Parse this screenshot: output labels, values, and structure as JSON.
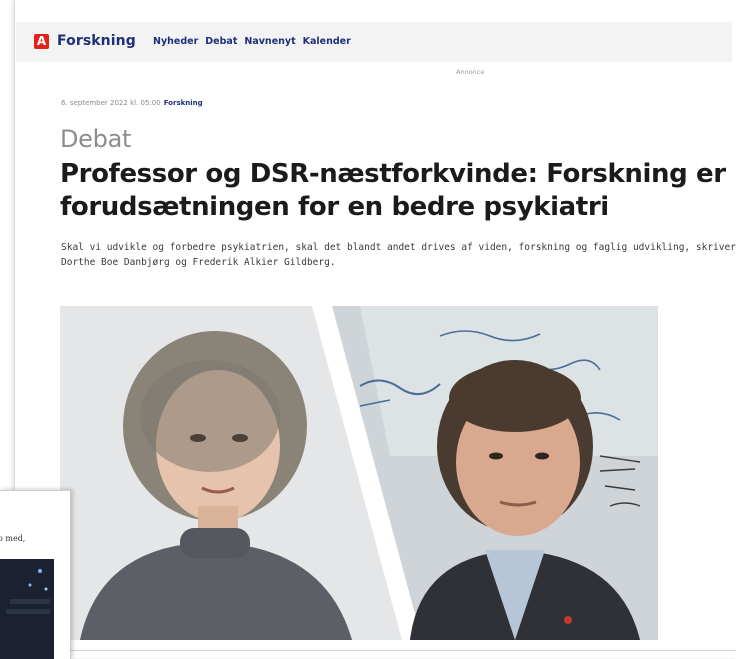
{
  "site": {
    "logo_letter": "A",
    "name": "Forskning",
    "brand_color": "#1f2f7a",
    "logo_color": "#e2231a"
  },
  "nav": {
    "items": [
      "Nyheder",
      "Debat",
      "Navnenyt",
      "Kalender"
    ]
  },
  "ad_label": "Annonce",
  "article": {
    "date": "6. september 2022 kl. 05:00",
    "category": "Forskning",
    "kicker": "Debat",
    "headline": "Professor og DSR-næstforkvinde: Forskning er forudsætningen for en bedre psykiatri",
    "lead": "Skal vi udvikle og forbedre psykiatrien, skal det blandt andet drives af viden, forskning og faglig udvikling, skriver Dorthe Boe Danbjørg og Frederik Alkier Gildberg."
  },
  "background_page": {
    "text_fragment": "o med,"
  }
}
